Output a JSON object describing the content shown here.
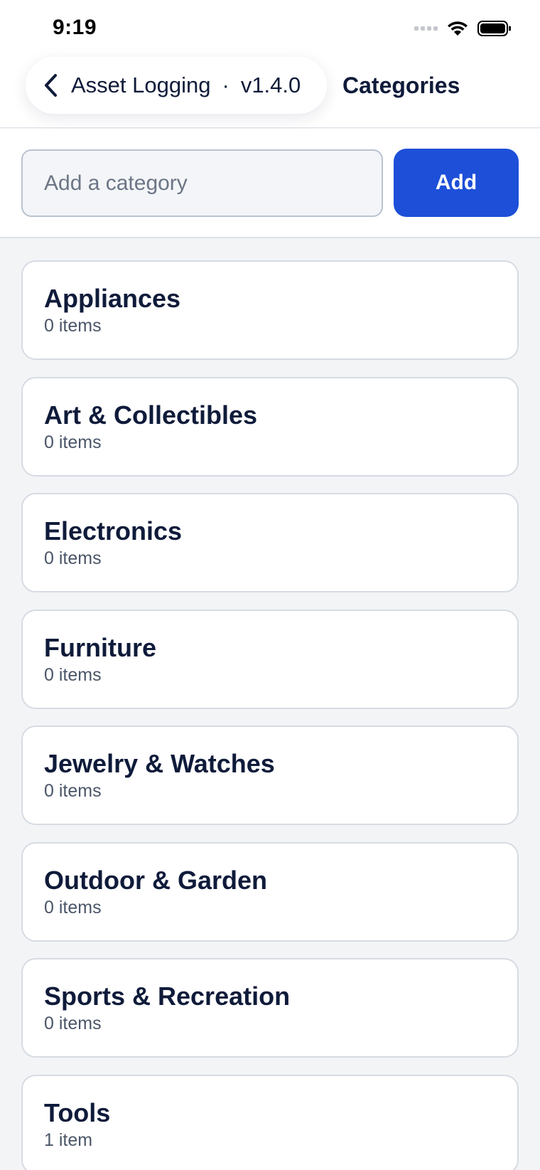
{
  "status_bar": {
    "time": "9:19",
    "icons": [
      "signal-dots-icon",
      "wifi-icon",
      "battery-icon"
    ]
  },
  "header": {
    "back_label": "Asset Logging",
    "separator": "·",
    "version": "v1.4.0",
    "title": "Categories"
  },
  "add_bar": {
    "input_placeholder": "Add a category",
    "input_value": "",
    "add_label": "Add"
  },
  "categories": [
    {
      "name": "Appliances",
      "count": "0 items"
    },
    {
      "name": "Art & Collectibles",
      "count": "0 items"
    },
    {
      "name": "Electronics",
      "count": "0 items"
    },
    {
      "name": "Furniture",
      "count": "0 items"
    },
    {
      "name": "Jewelry & Watches",
      "count": "0 items"
    },
    {
      "name": "Outdoor & Garden",
      "count": "0 items"
    },
    {
      "name": "Sports & Recreation",
      "count": "0 items"
    },
    {
      "name": "Tools",
      "count": "1 item"
    }
  ],
  "colors": {
    "accent": "#1d4fd8",
    "text": "#0f1b3a",
    "muted": "#4a5568",
    "background": "#f3f4f6"
  }
}
